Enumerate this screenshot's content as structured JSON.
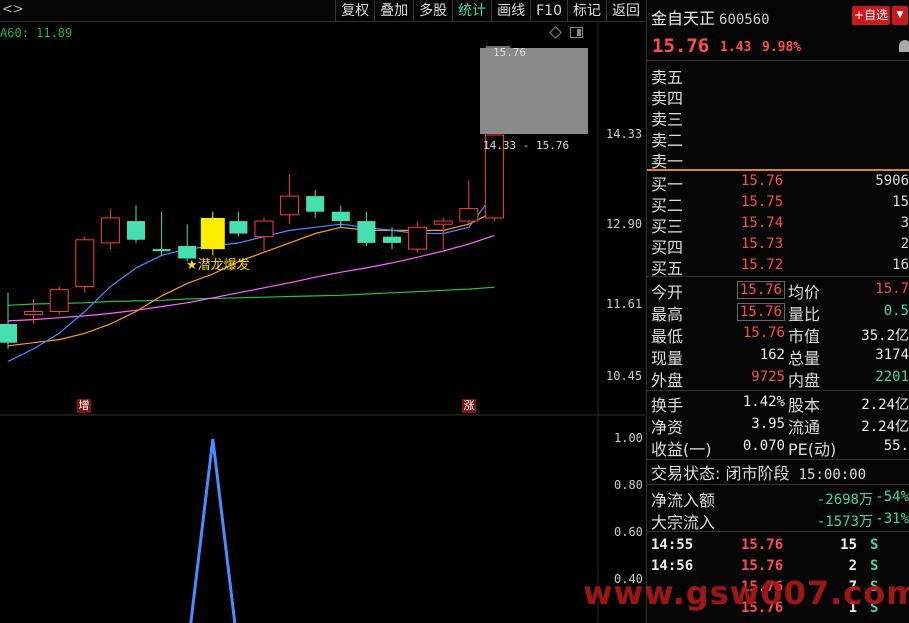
{
  "toolbar": {
    "left_text": "<>",
    "buttons": [
      {
        "label": "复权",
        "active": false
      },
      {
        "label": "叠加",
        "active": false
      },
      {
        "label": "多股",
        "active": false
      },
      {
        "label": "统计",
        "active": true
      },
      {
        "label": "画线",
        "active": false
      },
      {
        "label": "F10",
        "active": false
      },
      {
        "label": "标记",
        "active": false
      },
      {
        "label": "返回",
        "active": false
      }
    ]
  },
  "chart": {
    "ma_label": "A60: 11.89",
    "price_ticks": [
      "14.33",
      "12.90",
      "11.61",
      "10.45"
    ],
    "range_high_label": "15.76",
    "range_text": "14.33 - 15.76",
    "annotation": "★潜龙爆发",
    "badges": [
      "增",
      "涨"
    ],
    "indicator_ticks": [
      "1.00",
      "0.80",
      "0.60",
      "0.40"
    ],
    "colors": {
      "up": "#ff3b3b",
      "down": "#46e0b0",
      "signal": "#ffee00",
      "ma5": "#4a8cff",
      "ma10": "#ff9a1e",
      "ma20": "#ff66ff",
      "ma60": "#1fc43f"
    }
  },
  "chart_data": {
    "type": "candlestick",
    "y_range": [
      10.0,
      16.4
    ],
    "candles": [
      {
        "o": 11.3,
        "h": 11.8,
        "l": 10.9,
        "c": 11.0,
        "dir": "down"
      },
      {
        "o": 11.45,
        "h": 11.7,
        "l": 11.3,
        "c": 11.5,
        "dir": "up"
      },
      {
        "o": 11.5,
        "h": 11.9,
        "l": 11.45,
        "c": 11.85,
        "dir": "up"
      },
      {
        "o": 11.9,
        "h": 12.7,
        "l": 11.8,
        "c": 12.65,
        "dir": "up"
      },
      {
        "o": 12.6,
        "h": 13.15,
        "l": 12.5,
        "c": 13.0,
        "dir": "up"
      },
      {
        "o": 12.95,
        "h": 13.2,
        "l": 12.6,
        "c": 12.65,
        "dir": "down"
      },
      {
        "o": 12.5,
        "h": 13.1,
        "l": 12.4,
        "c": 12.5,
        "dir": "down"
      },
      {
        "o": 12.55,
        "h": 12.9,
        "l": 12.3,
        "c": 12.35,
        "dir": "down"
      },
      {
        "o": 12.5,
        "h": 13.1,
        "l": 12.4,
        "c": 13.0,
        "dir": "signal"
      },
      {
        "o": 12.95,
        "h": 13.1,
        "l": 12.7,
        "c": 12.75,
        "dir": "down"
      },
      {
        "o": 12.7,
        "h": 13.0,
        "l": 12.45,
        "c": 12.95,
        "dir": "up"
      },
      {
        "o": 13.05,
        "h": 13.7,
        "l": 12.9,
        "c": 13.35,
        "dir": "up"
      },
      {
        "o": 13.35,
        "h": 13.45,
        "l": 13.0,
        "c": 13.1,
        "dir": "down"
      },
      {
        "o": 13.1,
        "h": 13.2,
        "l": 12.85,
        "c": 12.95,
        "dir": "down"
      },
      {
        "o": 12.95,
        "h": 13.1,
        "l": 12.55,
        "c": 12.6,
        "dir": "down"
      },
      {
        "o": 12.7,
        "h": 12.85,
        "l": 12.5,
        "c": 12.6,
        "dir": "down"
      },
      {
        "o": 12.5,
        "h": 12.95,
        "l": 12.45,
        "c": 12.85,
        "dir": "up"
      },
      {
        "o": 12.9,
        "h": 13.0,
        "l": 12.5,
        "c": 12.95,
        "dir": "up"
      },
      {
        "o": 12.95,
        "h": 13.6,
        "l": 12.9,
        "c": 13.15,
        "dir": "up"
      },
      {
        "o": 13.0,
        "h": 14.33,
        "l": 12.95,
        "c": 14.33,
        "dir": "up"
      }
    ],
    "ma5": [
      10.7,
      10.9,
      11.15,
      11.5,
      11.9,
      12.2,
      12.4,
      12.5,
      12.55,
      12.6,
      12.7,
      12.8,
      12.85,
      12.9,
      12.85,
      12.8,
      12.75,
      12.75,
      12.85,
      13.4
    ],
    "ma10": [
      10.95,
      11.0,
      11.05,
      11.15,
      11.3,
      11.5,
      11.75,
      11.95,
      12.1,
      12.3,
      12.45,
      12.6,
      12.75,
      12.85,
      12.8,
      12.8,
      12.8,
      12.8,
      12.9,
      13.1
    ],
    "ma20": [
      11.35,
      11.37,
      11.4,
      11.43,
      11.47,
      11.52,
      11.58,
      11.64,
      11.72,
      11.8,
      11.88,
      11.96,
      12.05,
      12.13,
      12.2,
      12.28,
      12.37,
      12.47,
      12.58,
      12.72
    ],
    "ma60": [
      11.6,
      11.62,
      11.63,
      11.64,
      11.66,
      11.67,
      11.68,
      11.7,
      11.71,
      11.72,
      11.73,
      11.74,
      11.75,
      11.76,
      11.78,
      11.8,
      11.82,
      11.84,
      11.86,
      11.89
    ],
    "indicator": {
      "peak_index": 8,
      "peak_value": 1.0,
      "range": [
        0.3,
        1.0
      ]
    }
  },
  "panel": {
    "stock_name": "金自天正",
    "stock_code": "600560",
    "fav_label": "+自选",
    "fav_dropdown": "▼",
    "price": "15.76",
    "change": "1.43",
    "change_pct": "9.98%",
    "sell": [
      {
        "label": "卖五",
        "price": "",
        "vol": ""
      },
      {
        "label": "卖四",
        "price": "",
        "vol": ""
      },
      {
        "label": "卖三",
        "price": "",
        "vol": ""
      },
      {
        "label": "卖二",
        "price": "",
        "vol": ""
      },
      {
        "label": "卖一",
        "price": "",
        "vol": ""
      }
    ],
    "buy": [
      {
        "label": "买一",
        "price": "15.76",
        "vol": "5906"
      },
      {
        "label": "买二",
        "price": "15.75",
        "vol": "15"
      },
      {
        "label": "买三",
        "price": "15.74",
        "vol": "3"
      },
      {
        "label": "买四",
        "price": "15.73",
        "vol": "2"
      },
      {
        "label": "买五",
        "price": "15.72",
        "vol": "16"
      }
    ],
    "stats": [
      {
        "l1": "今开",
        "v1": "15.76",
        "c1": "red",
        "boxed": true,
        "l2": "均价",
        "v2": "15.7",
        "c2": "red"
      },
      {
        "l1": "最高",
        "v1": "15.76",
        "c1": "red",
        "boxed": true,
        "l2": "量比",
        "v2": "0.5",
        "c2": "green"
      },
      {
        "l1": "最低",
        "v1": "15.76",
        "c1": "red",
        "boxed": false,
        "l2": "市值",
        "v2": "35.2亿",
        "c2": "white"
      },
      {
        "l1": "现量",
        "v1": "162",
        "c1": "white",
        "boxed": false,
        "l2": "总量",
        "v2": "3174",
        "c2": "white"
      },
      {
        "l1": "外盘",
        "v1": "9725",
        "c1": "red",
        "boxed": false,
        "l2": "内盘",
        "v2": "2201",
        "c2": "green"
      }
    ],
    "stats2": [
      {
        "l1": "换手",
        "v1": "1.42%",
        "c1": "white",
        "l2": "股本",
        "v2": "2.24亿",
        "c2": "white"
      },
      {
        "l1": "净资",
        "v1": "3.95",
        "c1": "white",
        "l2": "流通",
        "v2": "2.24亿",
        "c2": "white"
      },
      {
        "l1": "收益(一)",
        "v1": "0.070",
        "c1": "white",
        "l2": "PE(动)",
        "v2": "55.",
        "c2": "white"
      }
    ],
    "trade_status_label": "交易状态:",
    "trade_status_value": "闭市阶段",
    "trade_status_time": "15:00:00",
    "flows": [
      {
        "label": "净流入额",
        "v1": "-2698万",
        "v2": "-54%"
      },
      {
        "label": "大宗流入",
        "v1": "-1573万",
        "v2": "-31%"
      }
    ],
    "trades": [
      {
        "time": "14:55",
        "price": "15.76",
        "vol": "15",
        "flag": "S"
      },
      {
        "time": "14:56",
        "price": "15.76",
        "vol": "2",
        "flag": "S"
      },
      {
        "time": "",
        "price": "15.76",
        "vol": "7",
        "flag": "S"
      },
      {
        "time": "",
        "price": "15.76",
        "vol": "1",
        "flag": "S"
      }
    ],
    "watermark": "www.gsw007.com"
  }
}
